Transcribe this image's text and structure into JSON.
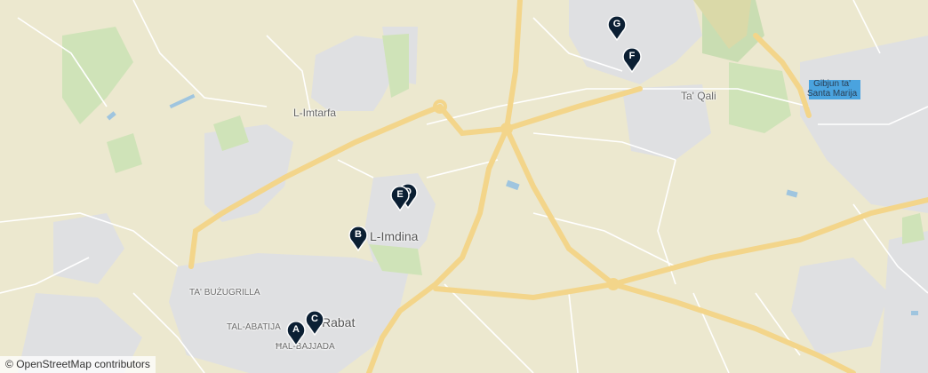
{
  "places": {
    "imdina": "L-Imdina",
    "rabat": "Rabat",
    "imtarfa": "L-Imtarfa",
    "taqali": "Ta' Qali",
    "gibjun": "Gibjun ta'\nSanta Marija",
    "tabuzugrilla": "TA' BUŻUGRILLA",
    "tal_abatija": "TAL-ABATIJA",
    "hal_bajjada": "ĦAL-BAJJADA"
  },
  "markers": [
    {
      "id": "A",
      "letter": "A"
    },
    {
      "id": "B",
      "letter": "B"
    },
    {
      "id": "C",
      "letter": "C"
    },
    {
      "id": "D",
      "letter": "D"
    },
    {
      "id": "E",
      "letter": "E"
    },
    {
      "id": "F",
      "letter": "F"
    },
    {
      "id": "G",
      "letter": "G"
    }
  ],
  "attribution": {
    "symbol": "©",
    "text": "OpenStreetMap contributors"
  },
  "colors": {
    "land": "#ece8cf",
    "urban": "#dfe0e2",
    "road_major": "#f3d58a",
    "road_minor": "#ffffff",
    "park": "#cfe3b8",
    "marker": "#0b1f33"
  }
}
